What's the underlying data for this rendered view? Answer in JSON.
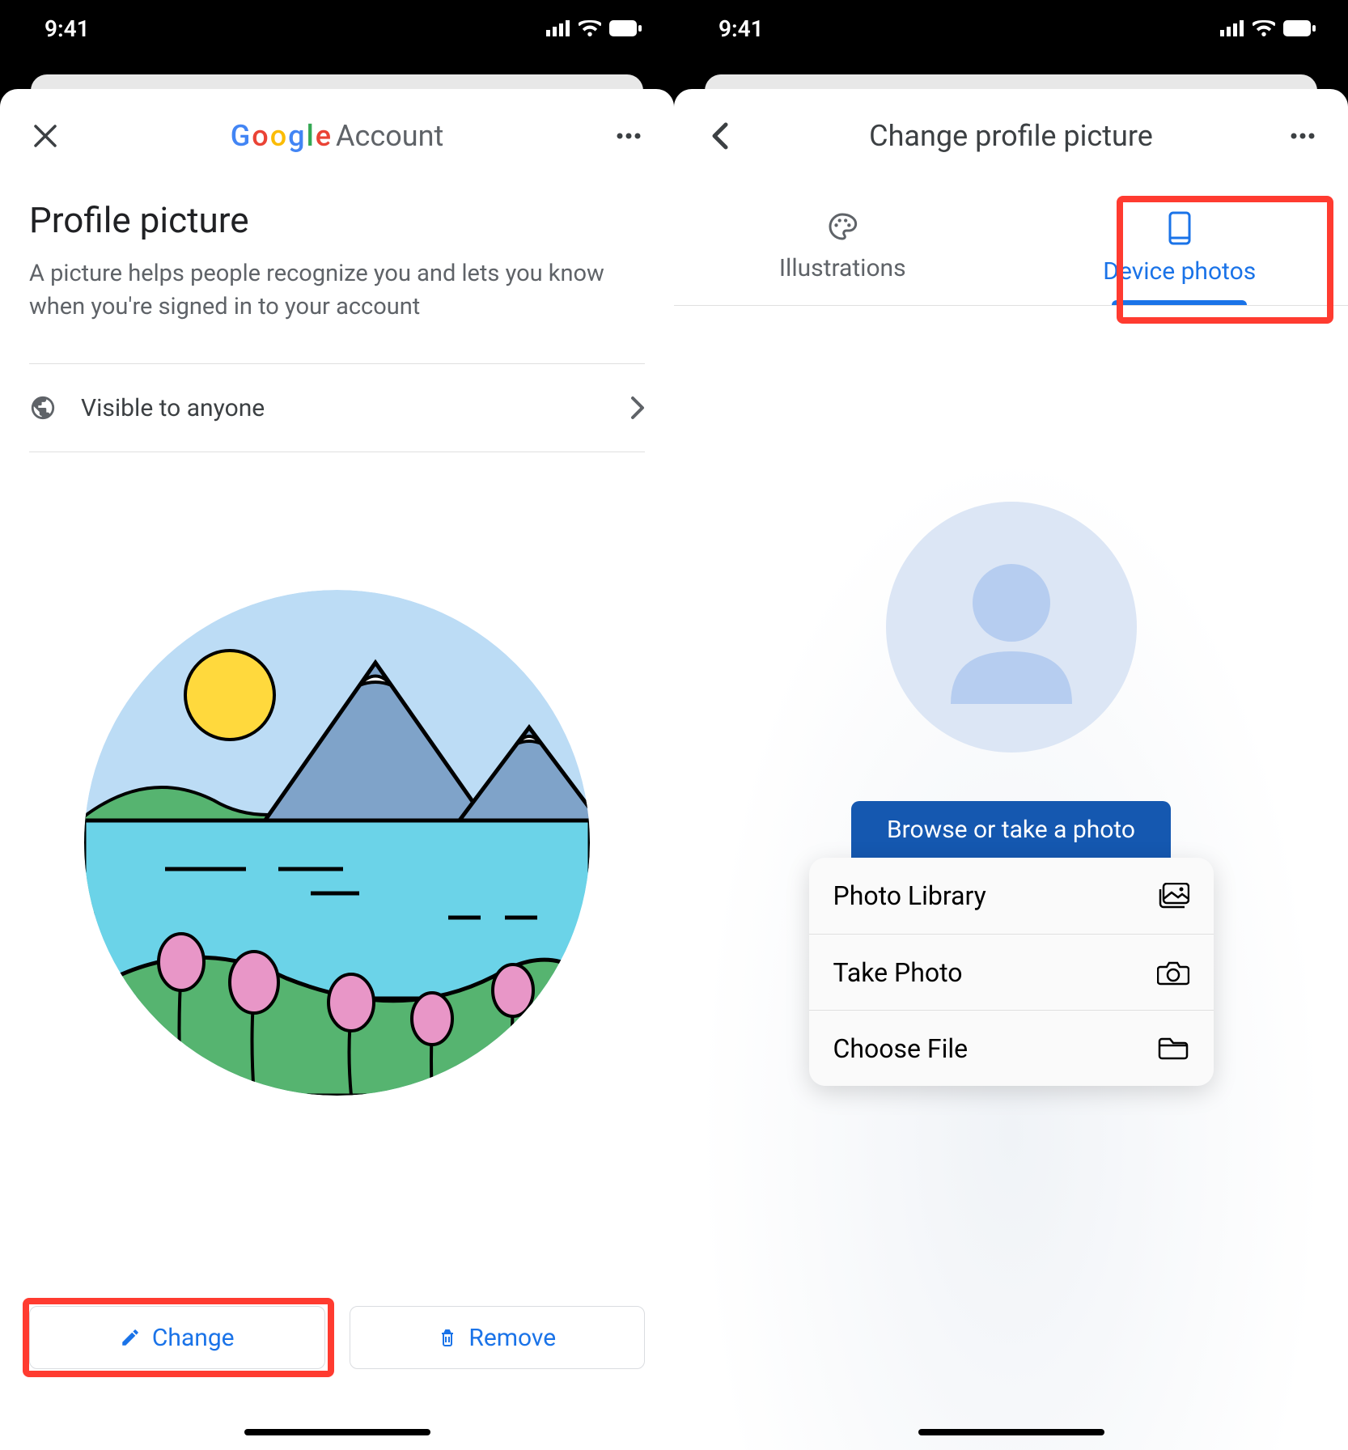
{
  "status": {
    "time": "9:41"
  },
  "screen1": {
    "brand_account_word": "Account",
    "section_title": "Profile picture",
    "helper_text": "A picture helps people recognize you and lets you know when you're signed in to your account",
    "visibility_label": "Visible to anyone",
    "change_button": "Change",
    "remove_button": "Remove"
  },
  "screen2": {
    "title": "Change profile picture",
    "tabs": {
      "illustrations": "Illustrations",
      "device_photos": "Device photos"
    },
    "browse_button": "Browse or take a photo",
    "menu": {
      "photo_library": "Photo Library",
      "take_photo": "Take Photo",
      "choose_file": "Choose File"
    }
  }
}
